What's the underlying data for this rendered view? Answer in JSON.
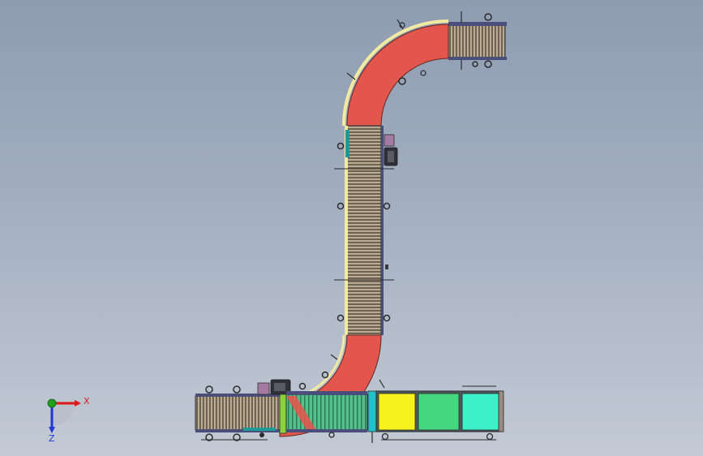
{
  "viewport": {
    "background_top": "#8e9cb2",
    "background_bottom": "#c3cad5"
  },
  "model": {
    "roller_color": "#6e6250",
    "curve_roller_color": "#e2564e",
    "belt_green_color": "#54c08c",
    "rail_color": "#f2eaa0",
    "yellow_module_color": "#f7f21e",
    "green_module_color": "#43d780",
    "cyan_module_color": "#3cf0c8"
  },
  "triad": {
    "x_label": "X",
    "z_label": "Z",
    "x_color": "#e01818",
    "z_color": "#2236d8",
    "y_color": "#1ea01e",
    "icon": "axis-triad-icon"
  }
}
